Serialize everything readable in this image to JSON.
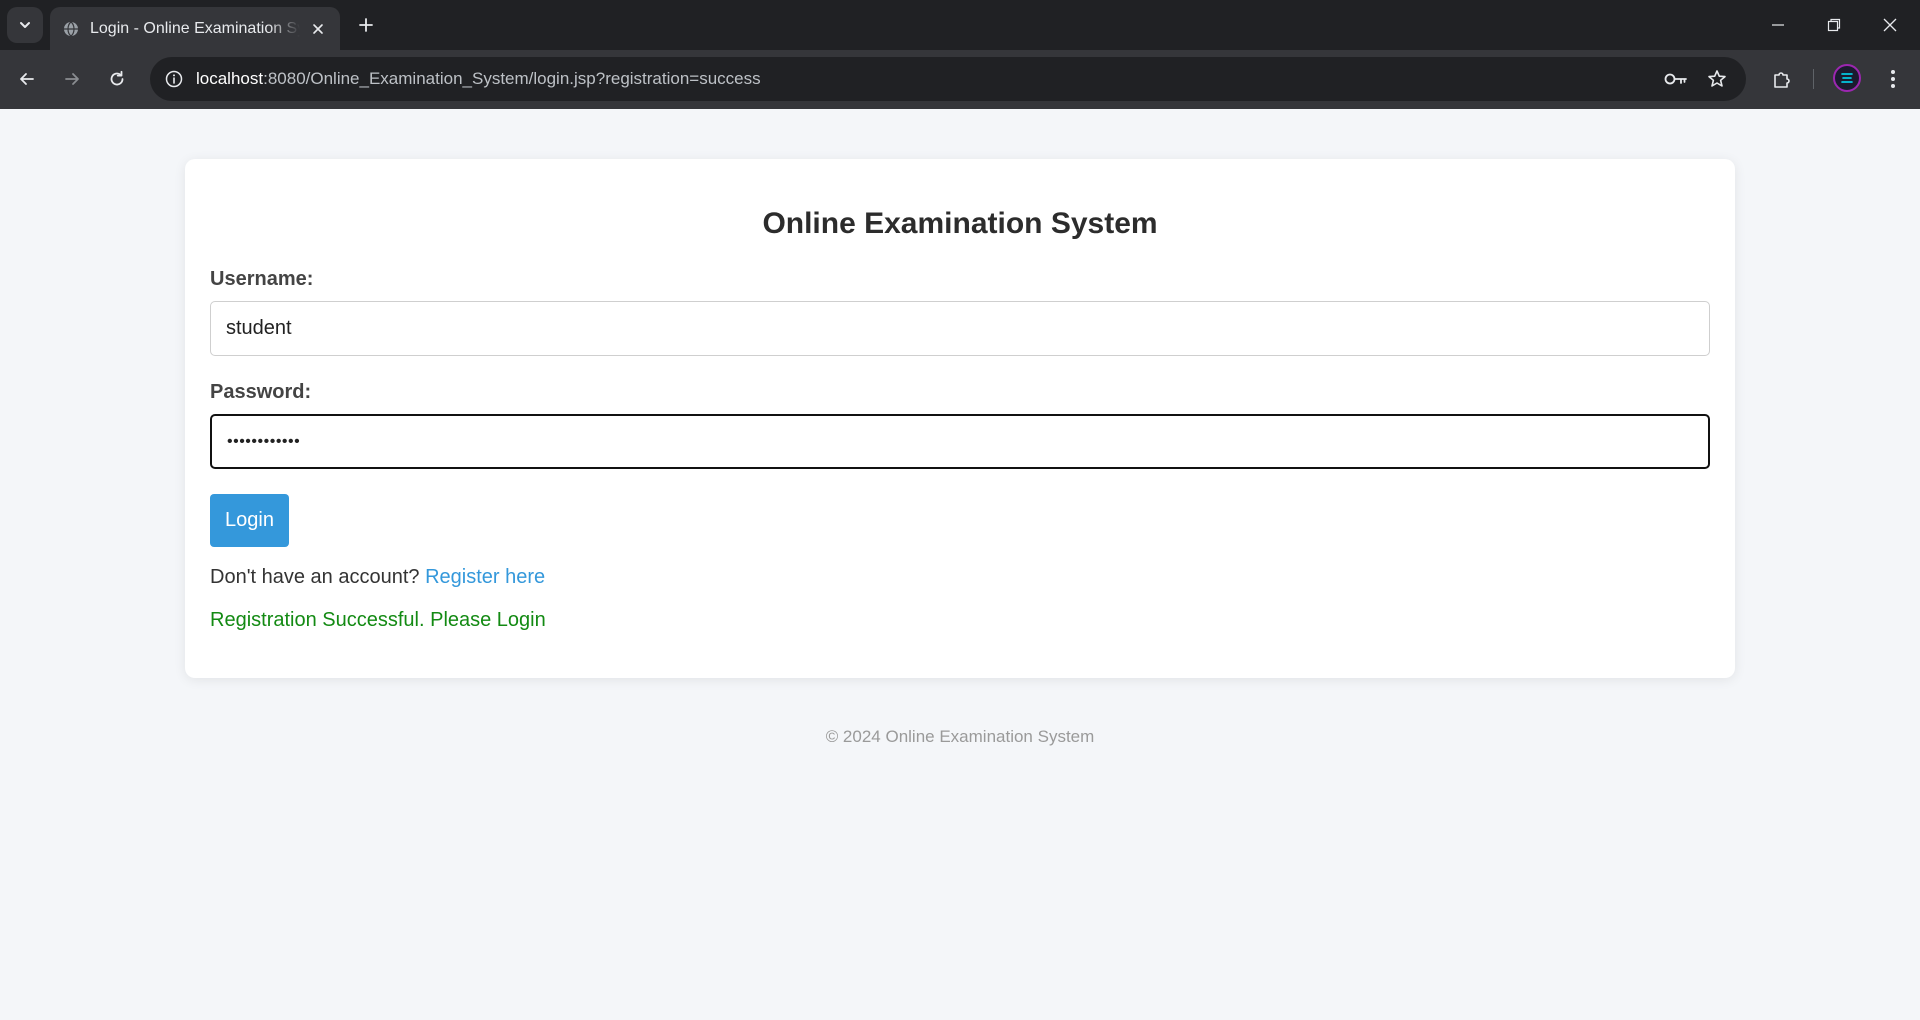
{
  "browser": {
    "tab_title": "Login - Online Examination System",
    "url_host": "localhost",
    "url_rest": ":8080/Online_Examination_System/login.jsp?registration=success"
  },
  "page": {
    "heading": "Online Examination System",
    "username_label": "Username:",
    "username_value": "student",
    "password_label": "Password:",
    "password_masked": "••••••••••••",
    "login_button": "Login",
    "register_prompt": "Don't have an account?",
    "register_link": "Register here",
    "success_message": "Registration Successful. Please Login",
    "footer": "© 2024 Online Examination System"
  },
  "colors": {
    "accent": "#3498db",
    "success": "#138a13",
    "page_bg": "#f4f6f9"
  }
}
